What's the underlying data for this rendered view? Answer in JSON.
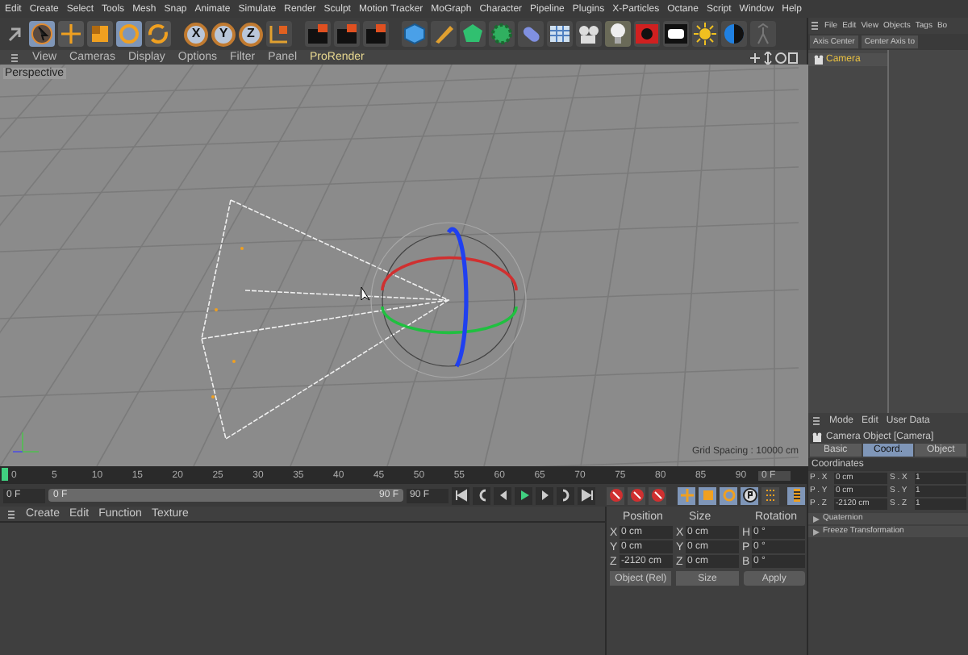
{
  "menu_bar": [
    "Edit",
    "Create",
    "Select",
    "Tools",
    "Mesh",
    "Snap",
    "Animate",
    "Simulate",
    "Render",
    "Sculpt",
    "Motion Tracker",
    "MoGraph",
    "Character",
    "Pipeline",
    "Plugins",
    "X-Particles",
    "Octane",
    "Script",
    "Window",
    "Help"
  ],
  "toolbar": {
    "axis_buttons": [
      "X",
      "Y",
      "Z"
    ]
  },
  "viewport": {
    "menu": [
      "View",
      "Cameras",
      "Display",
      "Options",
      "Filter",
      "Panel",
      "ProRender"
    ],
    "label": "Perspective",
    "grid_spacing": "Grid Spacing : 10000 cm"
  },
  "object_manager": {
    "menu": [
      "File",
      "Edit",
      "View",
      "Objects",
      "Tags",
      "Bo"
    ],
    "buttons": [
      "Axis Center",
      "Center Axis to"
    ],
    "objects": [
      {
        "name": "Camera",
        "selected": true
      }
    ]
  },
  "attributes": {
    "menu": [
      "Mode",
      "Edit",
      "User Data"
    ],
    "title": "Camera Object [Camera]",
    "tabs": [
      {
        "label": "Basic",
        "selected": false
      },
      {
        "label": "Coord.",
        "selected": true
      },
      {
        "label": "Object",
        "selected": false
      }
    ],
    "section": "Coordinates",
    "fields": [
      {
        "label": "P . X",
        "value": "0 cm"
      },
      {
        "label": "S . X",
        "value": "1"
      },
      {
        "label": "P . Y",
        "value": "0 cm"
      },
      {
        "label": "S . Y",
        "value": "1"
      },
      {
        "label": "P . Z",
        "value": "-2120 cm"
      },
      {
        "label": "S . Z",
        "value": "1"
      }
    ],
    "groups": [
      "Quaternion",
      "Freeze Transformation"
    ]
  },
  "timeline": {
    "ticks": [
      "0",
      "5",
      "10",
      "15",
      "20",
      "25",
      "30",
      "35",
      "40",
      "45",
      "50",
      "55",
      "60",
      "65",
      "70",
      "75",
      "80",
      "85",
      "90"
    ],
    "end_field": "0 F",
    "range_bar": {
      "level": 1
    },
    "start": "0 F",
    "range_start": "0 F",
    "range_end": "90 F",
    "end": "90 F"
  },
  "material_manager": {
    "menu": [
      "Create",
      "Edit",
      "Function",
      "Texture"
    ]
  },
  "coordinates": {
    "headers": [
      "Position",
      "Size",
      "Rotation"
    ],
    "rows": [
      {
        "axis": "X",
        "position": "0 cm",
        "size_axis": "X",
        "size": "0 cm",
        "rot_axis": "H",
        "rotation": "0 °"
      },
      {
        "axis": "Y",
        "position": "0 cm",
        "size_axis": "Y",
        "size": "0 cm",
        "rot_axis": "P",
        "rotation": "0 °"
      },
      {
        "axis": "Z",
        "position": "-2120 cm",
        "size_axis": "Z",
        "size": "0 cm",
        "rot_axis": "B",
        "rotation": "0 °"
      }
    ],
    "mode": "Object (Rel)",
    "size_mode": "Size",
    "apply": "Apply"
  }
}
